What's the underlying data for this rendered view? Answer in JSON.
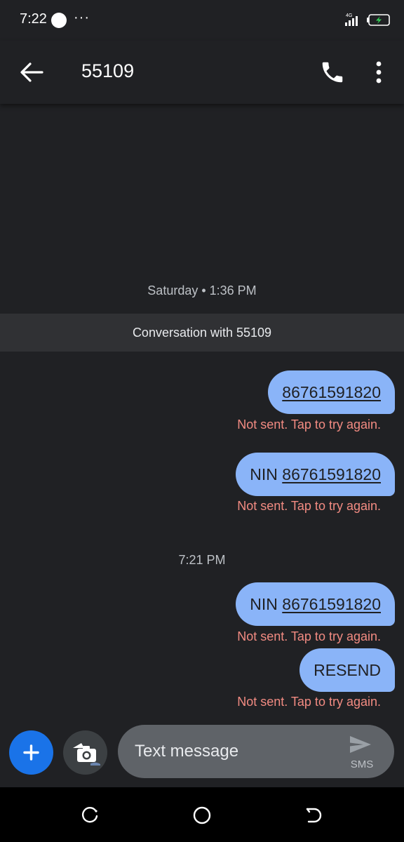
{
  "status_bar": {
    "time": "7:22",
    "more": "···",
    "network": "4G"
  },
  "app_bar": {
    "title": "55109"
  },
  "conversation": {
    "first_date": "Saturday • 1:36 PM",
    "banner": "Conversation with 55109",
    "second_date": "7:21 PM",
    "messages": [
      {
        "prefix": "",
        "link": "86761591820",
        "text": "",
        "status": "Not sent. Tap to try again."
      },
      {
        "prefix": "NIN ",
        "link": "86761591820",
        "text": "",
        "status": "Not sent. Tap to try again."
      },
      {
        "prefix": "NIN ",
        "link": "86761591820",
        "text": "",
        "status": "Not sent. Tap to try again."
      },
      {
        "prefix": "",
        "link": "",
        "text": "RESEND",
        "status": "Not sent. Tap to try again."
      }
    ]
  },
  "compose": {
    "placeholder": "Text message",
    "send_type": "SMS"
  },
  "colors": {
    "background": "#202124",
    "bubble": "#8ab4f8",
    "error": "#f28b82",
    "accent": "#1a73e8"
  },
  "icons": {
    "back": "arrow-left-icon",
    "call": "phone-icon",
    "more": "more-vert-icon",
    "add": "plus-icon",
    "camera": "camera-icon",
    "send": "send-icon"
  }
}
